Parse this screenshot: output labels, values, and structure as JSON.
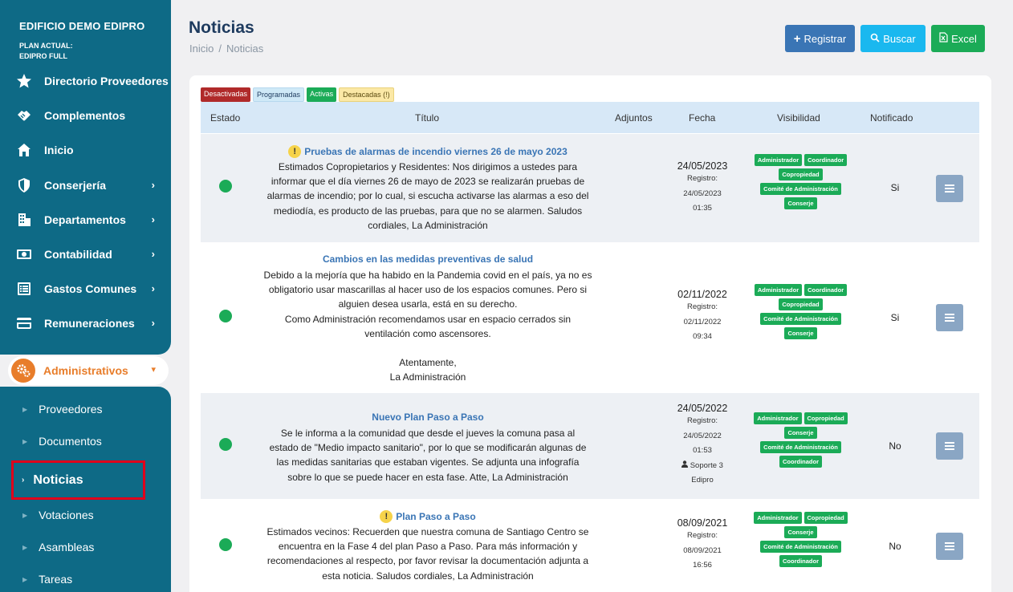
{
  "sidebar": {
    "building": "EDIFICIO DEMO EDIPRO",
    "plan_line1": "PLAN ACTUAL:",
    "plan_line2": "EDIPRO FULL",
    "items": [
      {
        "label": "Directorio Proveedores",
        "icon": "star-icon",
        "has_chevron": false
      },
      {
        "label": "Complementos",
        "icon": "handshake-icon",
        "has_chevron": false
      },
      {
        "label": "Inicio",
        "icon": "home-icon",
        "has_chevron": false
      },
      {
        "label": "Conserjería",
        "icon": "shield-icon",
        "has_chevron": true
      },
      {
        "label": "Departamentos",
        "icon": "building-icon",
        "has_chevron": true
      },
      {
        "label": "Contabilidad",
        "icon": "money-icon",
        "has_chevron": true
      },
      {
        "label": "Gastos Comunes",
        "icon": "list-icon",
        "has_chevron": true
      },
      {
        "label": "Remuneraciones",
        "icon": "card-icon",
        "has_chevron": true
      }
    ],
    "admin_label": "Administrativos",
    "sub_items": [
      "Proveedores",
      "Documentos",
      "Noticias",
      "Votaciones",
      "Asambleas",
      "Tareas"
    ]
  },
  "header": {
    "title": "Noticias",
    "breadcrumb_home": "Inicio",
    "breadcrumb_sep": "/",
    "breadcrumb_current": "Noticias",
    "btn_registrar": "Registrar",
    "btn_buscar": "Buscar",
    "btn_excel": "Excel"
  },
  "legend": {
    "desactivadas": "Desactivadas",
    "programadas": "Programadas",
    "activas": "Activas",
    "destacadas": "Destacadas (!)"
  },
  "table": {
    "headers": {
      "estado": "Estado",
      "titulo": "Título",
      "adjuntos": "Adjuntos",
      "fecha": "Fecha",
      "visibilidad": "Visibilidad",
      "notificado": "Notificado"
    },
    "rows": [
      {
        "highlighted": true,
        "title": "Pruebas de alarmas de incendio viernes 26 de mayo 2023",
        "body": "Estimados Copropietarios y Residentes: Nos dirigimos a ustedes para\ninformar que el día viernes 26 de mayo de  2023 se realizarán pruebas de\nalarmas de incendio; por lo cual, si escucha activarse las alarmas a eso del\nmediodía, es producto de las pruebas, para que no se alarmen. Saludos\ncordiales, La Administración",
        "fecha": "24/05/2023",
        "registro_label": "Registro:",
        "registro_fecha": "24/05/2023",
        "registro_hora": "01:35",
        "autor": "",
        "autor2": "",
        "visibilidad": [
          "Administrador",
          "Coordinador",
          "Copropiedad",
          "Comité de Administración",
          "Conserje"
        ],
        "notificado": "Si"
      },
      {
        "highlighted": false,
        "title": "Cambios en las medidas preventivas de salud",
        "body": "Debido a la mejoría que ha habido en la Pandemia covid en el país, ya no es\nobligatorio usar mascarillas al hacer uso de los espacios comunes. Pero si\nalguien desea usarla, está en su derecho.\nComo Administración recomendamos usar en espacio cerrados sin\nventilación como ascensores.\n\nAtentamente,\nLa Administración",
        "fecha": "02/11/2022",
        "registro_label": "Registro:",
        "registro_fecha": "02/11/2022",
        "registro_hora": "09:34",
        "autor": "",
        "autor2": "",
        "visibilidad": [
          "Administrador",
          "Coordinador",
          "Copropiedad",
          "Comité de Administración",
          "Conserje"
        ],
        "notificado": "Si"
      },
      {
        "highlighted": false,
        "title": "Nuevo Plan Paso a Paso",
        "body": "Se le informa a la comunidad que desde el jueves la comuna pasa al\nestado de \"Medio impacto sanitario\", por lo que se modificarán algunas de\nlas medidas sanitarias que estaban vigentes. Se adjunta una infografía\nsobre lo que se puede hacer en esta fase.   Atte, La Administración",
        "fecha": "24/05/2022",
        "registro_label": "Registro:",
        "registro_fecha": "24/05/2022",
        "registro_hora": "01:53",
        "autor": "Soporte 3",
        "autor2": "Edipro",
        "visibilidad": [
          "Administrador",
          "Copropiedad",
          "Conserje",
          "Comité de Administración",
          "Coordinador"
        ],
        "notificado": "No"
      },
      {
        "highlighted": true,
        "title": "Plan Paso a Paso",
        "body": "Estimados vecinos: Recuerden que nuestra comuna de Santiago Centro se\nencuentra en la Fase 4 del plan Paso a Paso. Para más información y\nrecomendaciones al respecto, por favor revisar la documentación adjunta a\nesta noticia. Saludos cordiales, La Administración",
        "fecha": "08/09/2021",
        "registro_label": "Registro:",
        "registro_fecha": "08/09/2021",
        "registro_hora": "16:56",
        "autor": "",
        "autor2": "",
        "visibilidad": [
          "Administrador",
          "Copropiedad",
          "Conserje",
          "Comité de Administración",
          "Coordinador"
        ],
        "notificado": "No"
      }
    ]
  },
  "colors": {
    "sidebar": "#0e6a86",
    "accent_orange": "#e87d2a",
    "primary": "#3a75b5",
    "info": "#1ab8ef",
    "success": "#1bab57",
    "danger": "#b02a2a"
  }
}
